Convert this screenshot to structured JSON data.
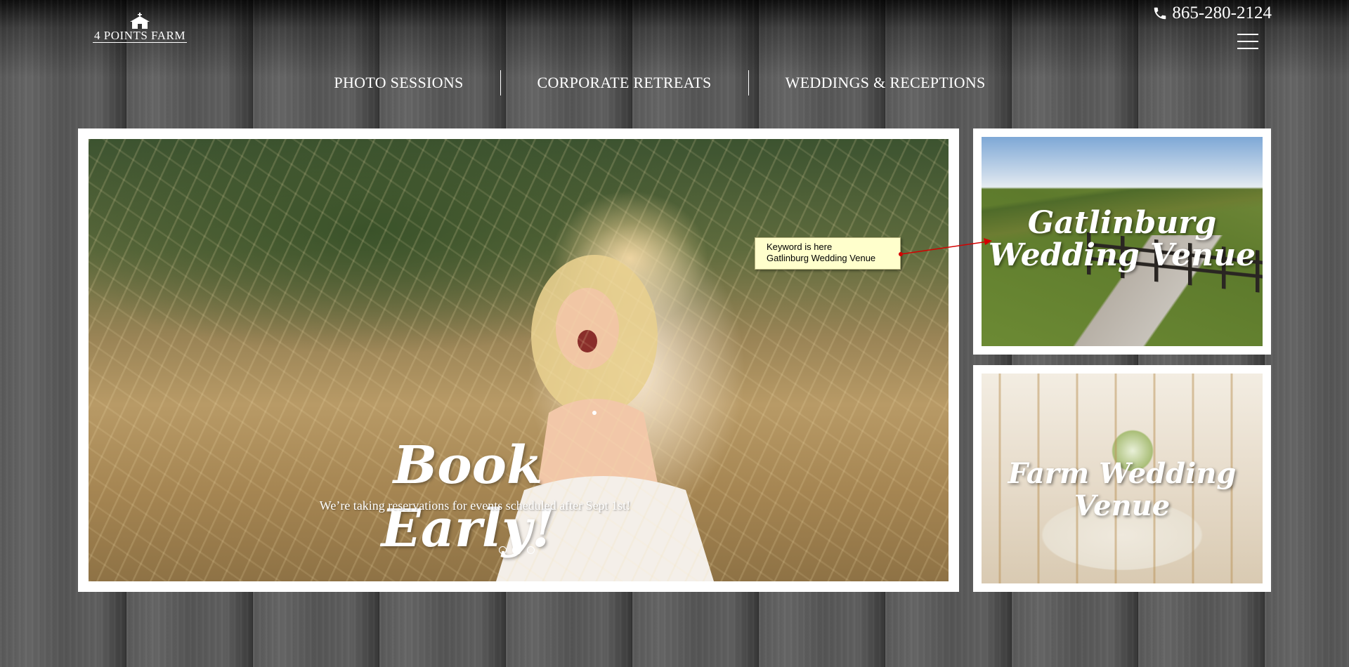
{
  "header": {
    "logo_text": "4 POINTS FARM",
    "phone": "865-280-2124"
  },
  "nav": {
    "items": [
      {
        "label": "PHOTO SESSIONS"
      },
      {
        "label": "CORPORATE RETREATS"
      },
      {
        "label": "WEDDINGS & RECEPTIONS"
      }
    ]
  },
  "slider": {
    "title": "Book Early!",
    "subtitle": "We’re taking reservations for events scheduled after Sept 1st!",
    "slide_count": 3,
    "active_slide": 2
  },
  "cards": [
    {
      "title": "Gatlinburg Wedding Venue"
    },
    {
      "title": "Farm Wedding Venue"
    }
  ],
  "annotation": {
    "line1": "Keyword is here",
    "line2": "Gatlinburg Wedding Venue",
    "arrow_color": "#d40000"
  },
  "icons": {
    "phone": "phone-icon",
    "menu": "hamburger-menu-icon",
    "logo": "barn-logo-icon"
  },
  "colors": {
    "frame": "#ffffff",
    "text": "#ffffff",
    "callout_bg": "#ffffcc"
  }
}
